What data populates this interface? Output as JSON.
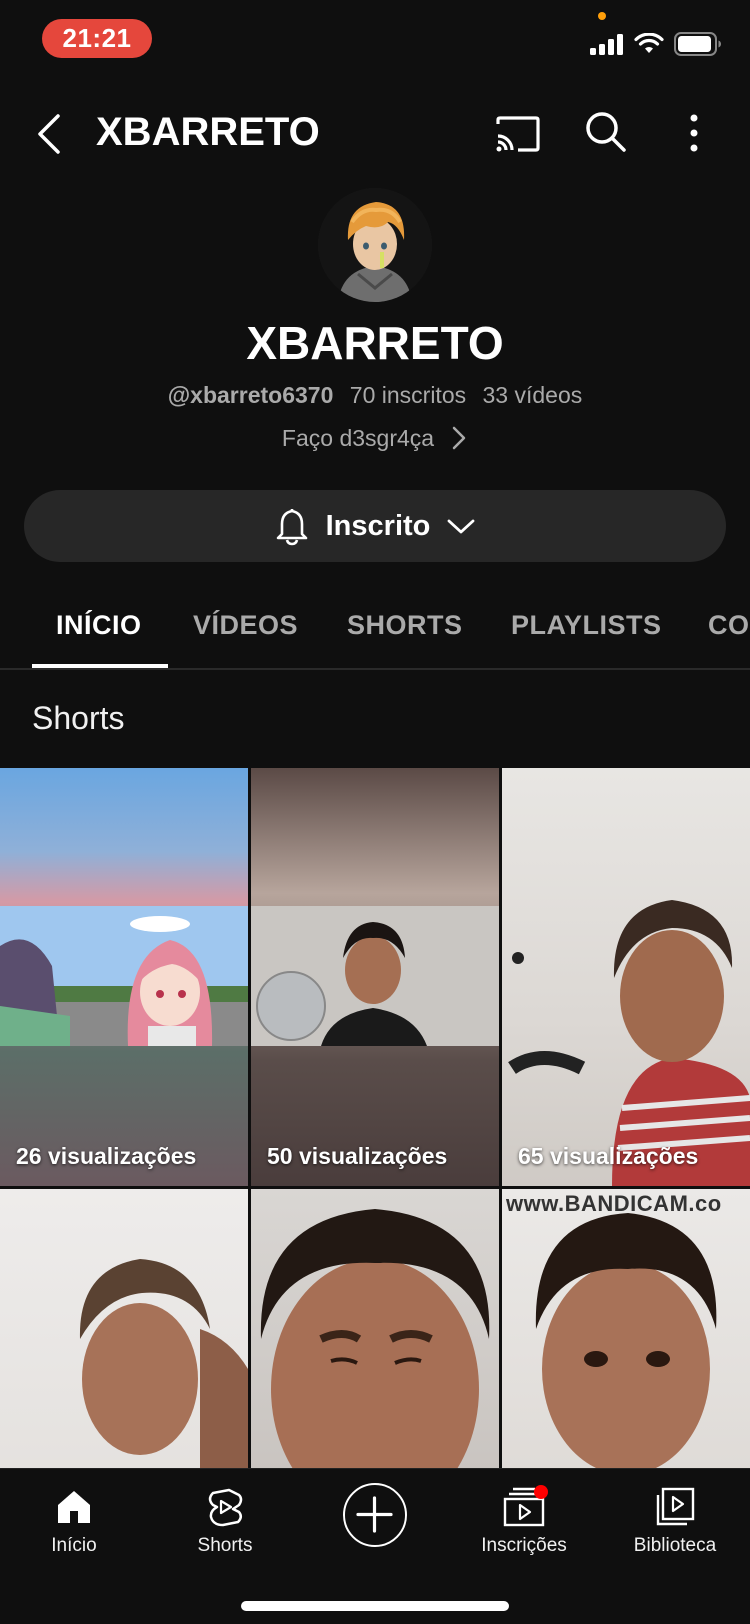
{
  "status_bar": {
    "time": "21:21"
  },
  "header": {
    "title": "XBARRETO"
  },
  "channel": {
    "name": "XBARRETO",
    "handle": "@xbarreto6370",
    "subscribers": "70 inscritos",
    "videos": "33 vídeos",
    "description": "Faço d3sgr4ça",
    "subscribe_label": "Inscrito"
  },
  "tabs": [
    {
      "label": "INÍCIO",
      "active": true
    },
    {
      "label": "VÍDEOS"
    },
    {
      "label": "SHORTS"
    },
    {
      "label": "PLAYLISTS"
    },
    {
      "label": "CO"
    }
  ],
  "section": {
    "title": "Shorts"
  },
  "shorts": [
    {
      "views": "26 visualizações"
    },
    {
      "views": "50 visualizações"
    },
    {
      "views": "65 visualizações"
    },
    {
      "views": ""
    },
    {
      "views": ""
    },
    {
      "views": "",
      "watermark": "www.BANDICAM.co"
    }
  ],
  "nav": {
    "home": "Início",
    "shorts": "Shorts",
    "subscriptions": "Inscrições",
    "library": "Biblioteca"
  },
  "colors": {
    "accent": "#ff0000",
    "time_pill": "#e5473c",
    "background": "#0f0f0f"
  }
}
